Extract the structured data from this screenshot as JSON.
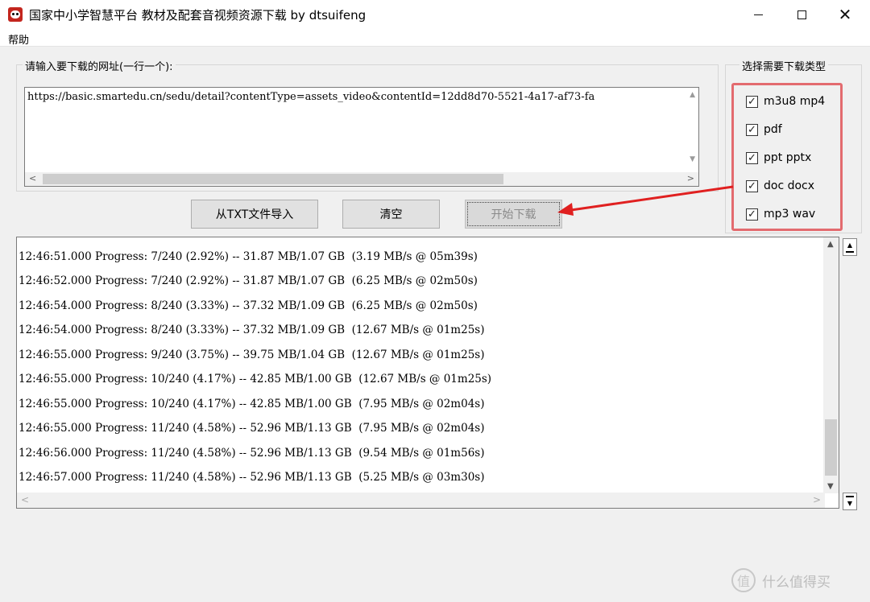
{
  "window": {
    "title": "国家中小学智慧平台 教材及配套音视频资源下载 by dtsuifeng",
    "app_icon": "panda-icon"
  },
  "menu": {
    "help": "帮助"
  },
  "url_group": {
    "label": "请输入要下载的网址(一行一个):",
    "value": "https://basic.smartedu.cn/sedu/detail?contentType=assets_video&contentId=12dd8d70-5521-4a17-af73-fa"
  },
  "type_group": {
    "label": "选择需要下载类型",
    "options": [
      {
        "label": "m3u8 mp4",
        "checked": true
      },
      {
        "label": "pdf",
        "checked": true
      },
      {
        "label": "ppt pptx",
        "checked": true
      },
      {
        "label": "doc docx",
        "checked": true
      },
      {
        "label": "mp3 wav",
        "checked": true
      }
    ]
  },
  "buttons": {
    "import": "从TXT文件导入",
    "clear": "清空",
    "start": "开始下载"
  },
  "log": [
    "12:46:51.000 Progress: 7/240 (2.92%) -- 31.87 MB/1.07 GB  (3.19 MB/s @ 05m39s)",
    "12:46:52.000 Progress: 7/240 (2.92%) -- 31.87 MB/1.07 GB  (6.25 MB/s @ 02m50s)",
    "12:46:54.000 Progress: 8/240 (3.33%) -- 37.32 MB/1.09 GB  (6.25 MB/s @ 02m50s)",
    "12:46:54.000 Progress: 8/240 (3.33%) -- 37.32 MB/1.09 GB  (12.67 MB/s @ 01m25s)",
    "12:46:55.000 Progress: 9/240 (3.75%) -- 39.75 MB/1.04 GB  (12.67 MB/s @ 01m25s)",
    "12:46:55.000 Progress: 10/240 (4.17%) -- 42.85 MB/1.00 GB  (12.67 MB/s @ 01m25s)",
    "12:46:55.000 Progress: 10/240 (4.17%) -- 42.85 MB/1.00 GB  (7.95 MB/s @ 02m04s)",
    "12:46:55.000 Progress: 11/240 (4.58%) -- 52.96 MB/1.13 GB  (7.95 MB/s @ 02m04s)",
    "12:46:56.000 Progress: 11/240 (4.58%) -- 52.96 MB/1.13 GB  (9.54 MB/s @ 01m56s)",
    "12:46:57.000 Progress: 11/240 (4.58%) -- 52.96 MB/1.13 GB  (5.25 MB/s @ 03m30s)"
  ],
  "watermark": {
    "text": "什么值得买",
    "icon": "zhi-icon",
    "icon_glyph": "值"
  },
  "colors": {
    "highlight": "#e36b6f",
    "arrow": "#e02020"
  }
}
